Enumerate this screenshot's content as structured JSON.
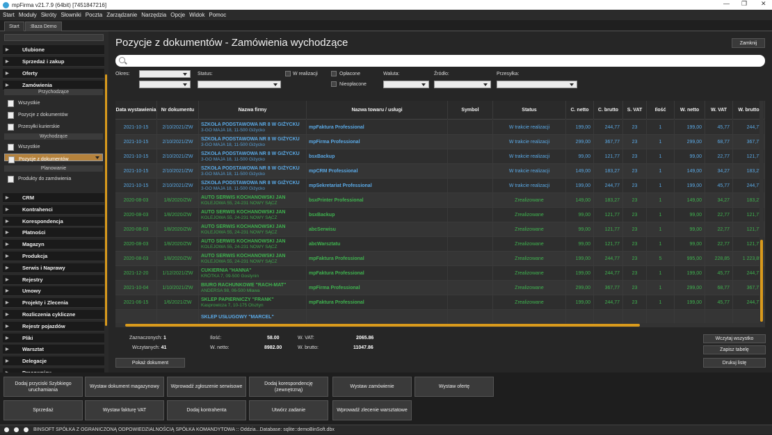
{
  "window": {
    "title": "mpFirma v21.7.9 (64bit) [7451847216]"
  },
  "menu": [
    "Start",
    "Moduły",
    "Skróty",
    "Słowniki",
    "Poczta",
    "Zarządzanie",
    "Narzędzia",
    "Opcje",
    "Widok",
    "Pomoc"
  ],
  "tabs": [
    "Start",
    ":Baza Demo"
  ],
  "sidebar": {
    "groups_top": [
      "Ulubione",
      "Sprzedaż i zakup",
      "Oferty",
      "Zamówienia"
    ],
    "sub_przychodzace": "Przychodzące",
    "items_przychodzace": [
      "Wszystkie",
      "Pozycje z dokumentów",
      "Przesyłki kurierskie"
    ],
    "sub_wychodzace": "Wychodzące",
    "items_wychodzace": [
      "Wszystkie",
      "Pozycje z dokumentów"
    ],
    "sub_planowanie": "Planowanie",
    "items_planowanie": [
      "Produkty do zamówienia"
    ],
    "groups_bottom": [
      "CRM",
      "Kontrahenci",
      "Korespondencja",
      "Płatności",
      "Magazyn",
      "Produkcja",
      "Serwis i Naprawy",
      "Rejestry",
      "Umowy",
      "Projekty i Zlecenia",
      "Rozliczenia cykliczne",
      "Rejestr pojazdów",
      "Pliki",
      "Warsztat",
      "Delegacje",
      "Pracownicy"
    ]
  },
  "main": {
    "title": "Pozycje z dokumentów - Zamówienia wychodzące",
    "close_label": "Zamknij",
    "filters": {
      "okres": "Okres:",
      "status": "Status:",
      "w_realizacji": "W realizacji",
      "oplacone": "Opłacone",
      "nieoplacone": "Nieopłacone",
      "waluta": "Waluta:",
      "zrodlo": "Źródło:",
      "przesylka": "Przesyłka:"
    },
    "columns": [
      "Data wystawienia",
      "Nr dokumentu",
      "Nazwa firmy",
      "Nazwa towaru / usługi",
      "Symbol",
      "Status",
      "C. netto",
      "C. brutto",
      "S. VAT",
      "Ilość",
      "W. netto",
      "W. VAT",
      "W. brutto"
    ],
    "rows": [
      {
        "date": "2021-10-15",
        "nr": "2/10/2021/ZW",
        "firm": "SZKOŁA PODSTAWOWA NR 8 W GIŻYCKU",
        "addr": "3-GO MAJA 18, 11-500 Giżycko",
        "product": "mpFaktura Professional",
        "symbol": "",
        "status": "W trakcie realizacji",
        "cn": "199,00",
        "cb": "244,77",
        "vat": "23",
        "qty": "1",
        "wn": "199,00",
        "wv": "45,77",
        "wb": "244,77",
        "color": "blue"
      },
      {
        "date": "2021-10-15",
        "nr": "2/10/2021/ZW",
        "firm": "SZKOŁA PODSTAWOWA NR 8 W GIŻYCKU",
        "addr": "3-GO MAJA 18, 11-500 Giżycko",
        "product": "mpFirma Professional",
        "symbol": "",
        "status": "W trakcie realizacji",
        "cn": "299,00",
        "cb": "367,77",
        "vat": "23",
        "qty": "1",
        "wn": "299,00",
        "wv": "68,77",
        "wb": "367,77",
        "color": "blue"
      },
      {
        "date": "2021-10-15",
        "nr": "2/10/2021/ZW",
        "firm": "SZKOŁA PODSTAWOWA NR 8 W GIŻYCKU",
        "addr": "3-GO MAJA 18, 11-500 Giżycko",
        "product": "bsxBackup",
        "symbol": "",
        "status": "W trakcie realizacji",
        "cn": "99,00",
        "cb": "121,77",
        "vat": "23",
        "qty": "1",
        "wn": "99,00",
        "wv": "22,77",
        "wb": "121,77",
        "color": "blue"
      },
      {
        "date": "2021-10-15",
        "nr": "2/10/2021/ZW",
        "firm": "SZKOŁA PODSTAWOWA NR 8 W GIŻYCKU",
        "addr": "3-GO MAJA 18, 11-500 Giżycko",
        "product": "mpCRM Professional",
        "symbol": "",
        "status": "W trakcie realizacji",
        "cn": "149,00",
        "cb": "183,27",
        "vat": "23",
        "qty": "1",
        "wn": "149,00",
        "wv": "34,27",
        "wb": "183,27",
        "color": "blue"
      },
      {
        "date": "2021-10-15",
        "nr": "2/10/2021/ZW",
        "firm": "SZKOŁA PODSTAWOWA NR 8 W GIŻYCKU",
        "addr": "3-GO MAJA 18, 11-500 Giżycko",
        "product": "mpSekretariat Professional",
        "symbol": "",
        "status": "W trakcie realizacji",
        "cn": "199,00",
        "cb": "244,77",
        "vat": "23",
        "qty": "1",
        "wn": "199,00",
        "wv": "45,77",
        "wb": "244,77",
        "color": "blue"
      },
      {
        "date": "2020-08-03",
        "nr": "1/8/2020/ZW",
        "firm": "AUTO SERWIS KOCHANOWSKI JAN",
        "addr": "KOLEJOWA 55, 24-231 NOWY SĄCZ",
        "product": "bsxPrinter Professional",
        "symbol": "",
        "status": "Zrealizowane",
        "cn": "149,00",
        "cb": "183,27",
        "vat": "23",
        "qty": "1",
        "wn": "149,00",
        "wv": "34,27",
        "wb": "183,27",
        "color": "green"
      },
      {
        "date": "2020-08-03",
        "nr": "1/8/2020/ZW",
        "firm": "AUTO SERWIS KOCHANOWSKI JAN",
        "addr": "KOLEJOWA 55, 24-231 NOWY SĄCZ",
        "product": "bsxBackup",
        "symbol": "",
        "status": "Zrealizowane",
        "cn": "99,00",
        "cb": "121,77",
        "vat": "23",
        "qty": "1",
        "wn": "99,00",
        "wv": "22,77",
        "wb": "121,77",
        "color": "green"
      },
      {
        "date": "2020-08-03",
        "nr": "1/8/2020/ZW",
        "firm": "AUTO SERWIS KOCHANOWSKI JAN",
        "addr": "KOLEJOWA 55, 24-231 NOWY SĄCZ",
        "product": "abcSerwisu",
        "symbol": "",
        "status": "Zrealizowane",
        "cn": "99,00",
        "cb": "121,77",
        "vat": "23",
        "qty": "1",
        "wn": "99,00",
        "wv": "22,77",
        "wb": "121,77",
        "color": "green"
      },
      {
        "date": "2020-08-03",
        "nr": "1/8/2020/ZW",
        "firm": "AUTO SERWIS KOCHANOWSKI JAN",
        "addr": "KOLEJOWA 55, 24-231 NOWY SĄCZ",
        "product": "abcWarsztatu",
        "symbol": "",
        "status": "Zrealizowane",
        "cn": "99,00",
        "cb": "121,77",
        "vat": "23",
        "qty": "1",
        "wn": "99,00",
        "wv": "22,77",
        "wb": "121,77",
        "color": "green"
      },
      {
        "date": "2020-08-03",
        "nr": "1/8/2020/ZW",
        "firm": "AUTO SERWIS KOCHANOWSKI JAN",
        "addr": "KOLEJOWA 55, 24-231 NOWY SĄCZ",
        "product": "mpFaktura Professional",
        "symbol": "",
        "status": "Zrealizowane",
        "cn": "199,00",
        "cb": "244,77",
        "vat": "23",
        "qty": "5",
        "wn": "995,00",
        "wv": "228,85",
        "wb": "1 223,85",
        "color": "green"
      },
      {
        "date": "2021-12-20",
        "nr": "1/12/2021/ZW",
        "firm": "CUKIERNIA \"HANNA\"",
        "addr": "KRÓTKA 7, 09-500 Gostynin",
        "product": "mpFaktura Professional",
        "symbol": "",
        "status": "Zrealizowane",
        "cn": "199,00",
        "cb": "244,77",
        "vat": "23",
        "qty": "1",
        "wn": "199,00",
        "wv": "45,77",
        "wb": "244,77",
        "color": "green"
      },
      {
        "date": "2021-10-04",
        "nr": "1/10/2021/ZW",
        "firm": "BIURO RACHUNKOWE \"RACH-MAT\"",
        "addr": "ANDERSA 98, 06-500 Mława",
        "product": "mpFirma Professional",
        "symbol": "",
        "status": "Zrealizowane",
        "cn": "299,00",
        "cb": "367,77",
        "vat": "23",
        "qty": "1",
        "wn": "299,00",
        "wv": "68,77",
        "wb": "367,77",
        "color": "green"
      },
      {
        "date": "2021-06-15",
        "nr": "1/6/2021/ZW",
        "firm": "SKLEP PAPIERNICZY \"FRANK\"",
        "addr": "Kasprowicza 7, 10-175 Olsztyn",
        "product": "mpFaktura Professional",
        "symbol": "",
        "status": "Zrealizowane",
        "cn": "199,00",
        "cb": "244,77",
        "vat": "23",
        "qty": "1",
        "wn": "199,00",
        "wv": "45,77",
        "wb": "244,77",
        "color": "green"
      },
      {
        "date": "",
        "nr": "",
        "firm": "SKLEP USŁUGOWY \"MARCEL\"",
        "addr": "",
        "product": "",
        "symbol": "",
        "status": "",
        "cn": "",
        "cb": "",
        "vat": "",
        "qty": "",
        "wn": "",
        "wv": "",
        "wb": "",
        "color": "blue"
      }
    ],
    "summary": {
      "zaznaczonych_label": "Zaznaczonych:",
      "zaznaczonych": "1",
      "wczytanych_label": "Wczytanych:",
      "wczytanych": "41",
      "ilosc_label": "Ilość:",
      "ilosc": "58.00",
      "wnetto_label": "W. netto:",
      "wnetto": "8982.00",
      "wvat_label": "W. VAT:",
      "wvat": "2065.86",
      "wbrutto_label": "W. brutto:",
      "wbrutto": "11047.86"
    },
    "buttons": {
      "wczytaj": "Wczytaj wszystko",
      "zapisz": "Zapisz tabelę",
      "pokaz": "Pokaż dokument",
      "drukuj": "Drukuj listę"
    }
  },
  "quick": [
    "Dodaj przyciski Szybkiego uruchamiania",
    "Wystaw dokument magazynowy",
    "Wprowadź zgłoszenie serwisowe",
    "Dodaj korespondencję (zewnętrzną)",
    "Wystaw zamówienie",
    "Wystaw ofertę",
    "Sprzedaż",
    "Wystaw fakturę VAT",
    "Dodaj kontrahenta",
    "Utwórz zadanie",
    "Wprowadź zlecenie warsztatowe"
  ],
  "status": {
    "text": "BINSOFT SPÓŁKA Z OGRANICZONĄ ODPOWIEDZIALNOŚCIĄ SPÓŁKA KOMANDYTOWA :: Oddzia...Database: sqlite::demoBinSoft.dbx"
  }
}
